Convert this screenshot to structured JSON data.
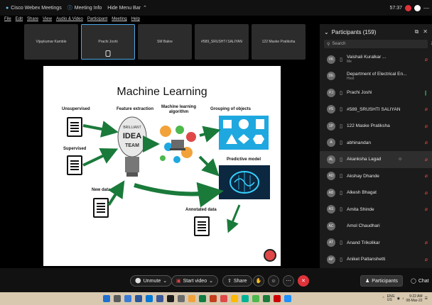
{
  "topbar": {
    "app": "Cisco Webex Meetings",
    "meeting_info": "Meeting Info",
    "hide_menu": "Hide Menu Bar",
    "time": "57:37"
  },
  "menu": [
    "File",
    "Edit",
    "Share",
    "View",
    "Audio & Video",
    "Participant",
    "Meeting",
    "Help"
  ],
  "thumbnails": [
    "Vijaykumar Kamble",
    "Prachi Joshi",
    "SM Bakre",
    "#589_SRUSHTI SALIYAN",
    "122 Maske Pratiksha"
  ],
  "slide": {
    "title": "Machine Learning",
    "unsupervised": "Unsupervised",
    "supervised": "Supervised",
    "new_data": "New data",
    "feature_extraction": "Feature extraction",
    "ml_algorithm": "Machine learning\nalgorithm",
    "grouping": "Grouping of objects",
    "predictive": "Predictive model",
    "annotated": "Annotated data",
    "bulb_words": "BRILLIANT\nIDEA\nTEAM"
  },
  "participants": {
    "title": "Participants (159)",
    "search_placeholder": "Search",
    "list": [
      {
        "initials": "VK",
        "name": "Vaishali Kuralkar ...",
        "sub": "Me",
        "state": "muted"
      },
      {
        "initials": "DE",
        "name": "Department of Electrical En...",
        "sub": "Host",
        "state": ""
      },
      {
        "initials": "PJ",
        "name": "Prachi Joshi",
        "sub": "",
        "state": "active"
      },
      {
        "initials": "#S",
        "name": "#589_SRUSHTI SALIYAN",
        "sub": "",
        "state": "muted"
      },
      {
        "initials": "1P",
        "name": "122 Maske Pratiksha",
        "sub": "",
        "state": "muted"
      },
      {
        "initials": "A",
        "name": "abhinandan",
        "sub": "",
        "state": "muted"
      },
      {
        "initials": "AL",
        "name": "Akanksha Lagad",
        "sub": "",
        "state": "muted"
      },
      {
        "initials": "AD",
        "name": "Akshay Dhande",
        "sub": "",
        "state": "muted"
      },
      {
        "initials": "AB",
        "name": "Alkesh Bhagat",
        "sub": "",
        "state": "muted"
      },
      {
        "initials": "AS",
        "name": "Amita Shinde",
        "sub": "",
        "state": "muted"
      },
      {
        "initials": "AC",
        "name": "Amol Chaudhari",
        "sub": "",
        "state": ""
      },
      {
        "initials": "AT",
        "name": "Anand Trikolikar",
        "sub": "",
        "state": "muted"
      },
      {
        "initials": "AP",
        "name": "Aniket Pattanshetti",
        "sub": "",
        "state": "muted"
      }
    ]
  },
  "controls": {
    "unmute": "Unmute",
    "start_video": "Start video",
    "share": "Share",
    "participants": "Participants",
    "chat": "Chat"
  },
  "tray": {
    "lang": "ENG\nUS",
    "time": "9:22 AM",
    "date": "08-Mar-22"
  },
  "colors": {
    "accent": "#4aa8e8",
    "muted": "#e04848",
    "leave": "#e0323a",
    "slide_blue": "#1fa8e0",
    "arrow_green": "#1a7a3a"
  }
}
